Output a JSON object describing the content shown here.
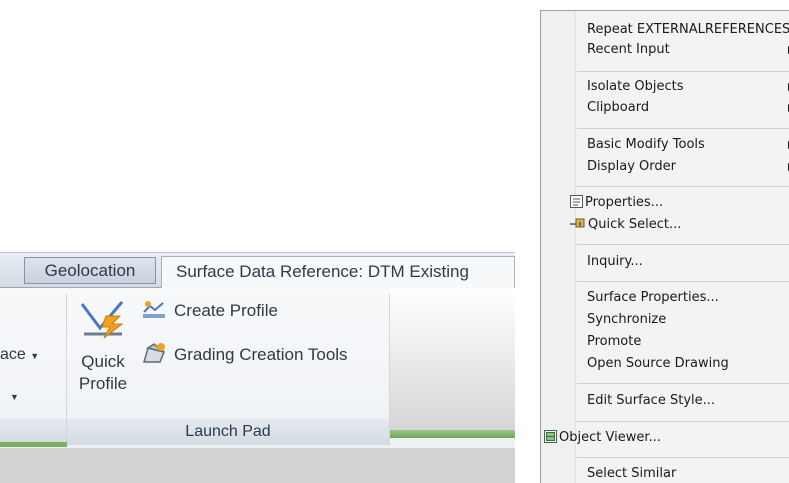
{
  "ribbon": {
    "tabs": {
      "geolocation": "Geolocation",
      "surface_context": "Surface Data Reference: DTM Existing"
    },
    "partial_left_label": "ace",
    "quick_profile": {
      "line1": "Quick",
      "line2": "Profile"
    },
    "commands": {
      "create_profile": "Create Profile",
      "grading_creation_tools": "Grading Creation Tools"
    },
    "panel_title": "Launch Pad"
  },
  "context_menu": {
    "items": {
      "repeat": "Repeat EXTERNALREFERENCES",
      "recent_input": "Recent Input",
      "isolate_objects": "Isolate Objects",
      "clipboard": "Clipboard",
      "basic_modify_tools": "Basic Modify Tools",
      "display_order": "Display Order",
      "properties": "Properties...",
      "quick_select": "Quick Select...",
      "inquiry": "Inquiry...",
      "surface_properties": "Surface Properties...",
      "synchronize": "Synchronize",
      "promote": "Promote",
      "open_source_drawing": "Open Source Drawing",
      "edit_surface_style": "Edit Surface Style...",
      "object_viewer": "Object Viewer...",
      "select_similar": "Select Similar"
    }
  }
}
